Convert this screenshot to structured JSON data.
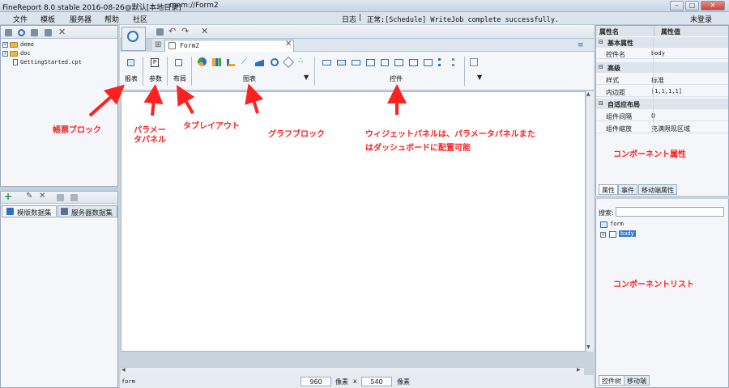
{
  "window": {
    "app_title": "FineReport 8.0 stable 2016-08-26@默认[本地目录]",
    "path": "mem://Form2",
    "controls": [
      "–",
      "□",
      "✕"
    ]
  },
  "menu": [
    "文件",
    "模板",
    "服务器",
    "帮助",
    "社区"
  ],
  "status": {
    "log": "日志",
    "separator": "|",
    "message": "正常:[Schedule] WriteJob complete successfully."
  },
  "login": "未登录",
  "left_tree": {
    "items": [
      {
        "label": "demo",
        "type": "folder"
      },
      {
        "label": "doc",
        "type": "folder"
      },
      {
        "label": "GettingStarted.cpt",
        "type": "file"
      }
    ]
  },
  "dataset": {
    "tabs": [
      "模版数据集",
      "服务器数据集"
    ]
  },
  "editor": {
    "tab": "Form2",
    "categories": {
      "report": "报表",
      "param": "参数",
      "layout": "布局",
      "chart": "图表",
      "widget": "控件"
    }
  },
  "canvas_size": {
    "label": "form",
    "width": "960",
    "unit": "像素",
    "by": "x",
    "height": "540"
  },
  "properties": {
    "headers": [
      "属性名",
      "属性值"
    ],
    "groups": [
      {
        "title": "基本属性",
        "rows": [
          {
            "name": "控件名",
            "value": "body"
          }
        ]
      },
      {
        "title": "高级",
        "rows": [
          {
            "name": "样式",
            "value": "标准"
          },
          {
            "name": "内边距",
            "value": "[1,1,1,1]"
          }
        ]
      },
      {
        "title": "自适应布局",
        "rows": [
          {
            "name": "组件间隔",
            "value": "0"
          },
          {
            "name": "组件缩放",
            "value": "充满限现区域"
          }
        ]
      }
    ],
    "tabs": [
      "属性",
      "事件",
      "移动端属性"
    ]
  },
  "components": {
    "search_label": "搜索:",
    "tree": [
      {
        "label": "form"
      },
      {
        "label": "body"
      }
    ],
    "tabs": [
      "控件树",
      "移动端"
    ]
  },
  "annotations": {
    "report_block": "帳票ブロック",
    "param_panel_1": "パラメー",
    "param_panel_2": "タパネル",
    "tab_layout": "タブレイアウト",
    "chart_block": "グラフブロック",
    "widget_panel_1": "ウィジェットパネルは、パラメータパネルまた",
    "widget_panel_2": "はダッシュボードに配置可能",
    "component_props": "コンポーネント属性",
    "component_list": "コンポーネントリスト"
  },
  "colors": {
    "accent": "#2f6fbf",
    "annotation": "#ff2020",
    "selection": "#3a78d0"
  }
}
